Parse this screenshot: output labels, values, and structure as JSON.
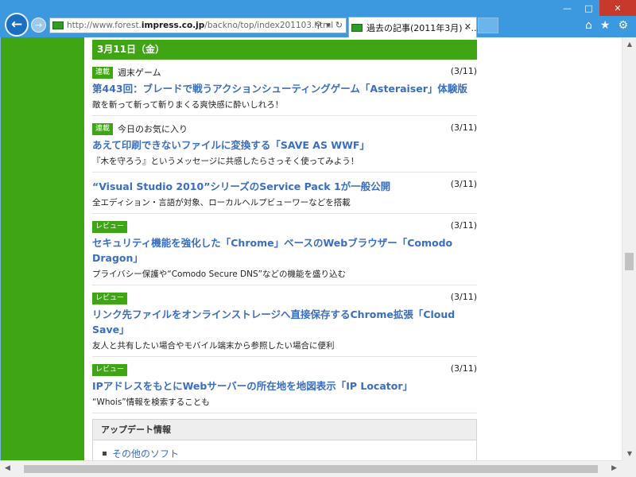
{
  "browser": {
    "url_prefix": "http://www.forest.",
    "url_domain": "impress.co.jp",
    "url_path": "/backno/top/index201103.html",
    "tab_title": "過去の記事(2011年3月) - ...",
    "favicon_text": "窓の杜",
    "icons": {
      "back": "back-arrow-icon",
      "forward": "forward-arrow-icon",
      "search": "search-icon",
      "dropdown": "chevron-down-icon",
      "refresh": "refresh-icon",
      "home": "home-icon",
      "favorites": "star-icon",
      "settings": "gear-icon"
    }
  },
  "page": {
    "date_header": "3月11日（金）",
    "articles": [
      {
        "badge": "連載",
        "series": "週末ゲーム",
        "date": "(3/11)",
        "title": "第443回：ブレードで戦うアクションシューティングゲーム「Asteraiser」体験版",
        "desc": "敵を斬って斬って斬りまくる爽快感に酔いしれろ！"
      },
      {
        "badge": "連載",
        "series": "今日のお気に入り",
        "date": "(3/11)",
        "title": "あえて印刷できないファイルに変換する「SAVE AS WWF」",
        "desc": "『木を守ろう』というメッセージに共感したらさっそく使ってみよう！"
      },
      {
        "badge": "",
        "series": "",
        "date": "(3/11)",
        "title": "“Visual Studio 2010”シリーズのService Pack 1が一般公開",
        "desc": "全エディション・言語が対象、ローカルヘルプビューワーなどを搭載"
      },
      {
        "badge": "レビュー",
        "series": "",
        "date": "(3/11)",
        "title": "セキュリティ機能を強化した「Chrome」ベースのWebブラウザー「Comodo Dragon」",
        "desc": "プライバシー保護や“Comodo Secure DNS”などの機能を盛り込む"
      },
      {
        "badge": "レビュー",
        "series": "",
        "date": "(3/11)",
        "title": "リンク先ファイルをオンラインストレージへ直接保存するChrome拡張「Cloud Save」",
        "desc": "友人と共有したい場合やモバイル端末から参照したい場合に便利"
      },
      {
        "badge": "レビュー",
        "series": "",
        "date": "(3/11)",
        "title": "IPアドレスをもとにWebサーバーの所在地を地図表示「IP Locator」",
        "desc": "“Whois”情報を検索することも"
      }
    ],
    "update_box": {
      "header": "アップデート情報",
      "link": "その他のソフト"
    }
  },
  "colors": {
    "brand_green": "#3fa514",
    "link_blue": "#3a6ec0",
    "chrome_blue": "#3c99e0",
    "close_red": "#c7392b"
  }
}
